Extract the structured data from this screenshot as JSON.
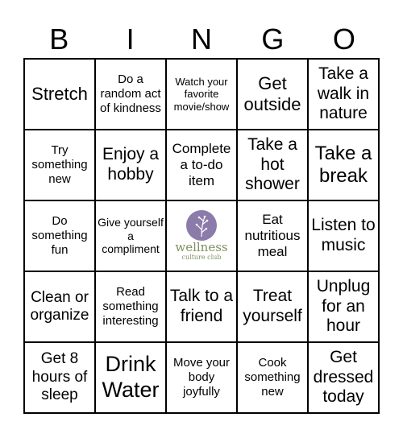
{
  "header": [
    "B",
    "I",
    "N",
    "G",
    "O"
  ],
  "cells": [
    "Stretch",
    "Do a random act of kindness",
    "Watch your favorite movie/show",
    "Get outside",
    "Take a walk in nature",
    "Try something new",
    "Enjoy a hobby",
    "Complete a to-do item",
    "Take a hot shower",
    "Take a break",
    "Do something fun",
    "Give yourself a compliment",
    "",
    "Eat nutritious meal",
    "Listen to music",
    "Clean or organize",
    "Read something interesting",
    "Talk to a friend",
    "Treat yourself",
    "Unplug for an hour",
    "Get 8 hours of sleep",
    "Drink Water",
    "Move your body joyfully",
    "Cook something new",
    "Get dressed today"
  ],
  "logo": {
    "name": "wellness",
    "tagline": "culture club",
    "circle_color": "#8b7baa",
    "text_color": "#7d9160"
  }
}
